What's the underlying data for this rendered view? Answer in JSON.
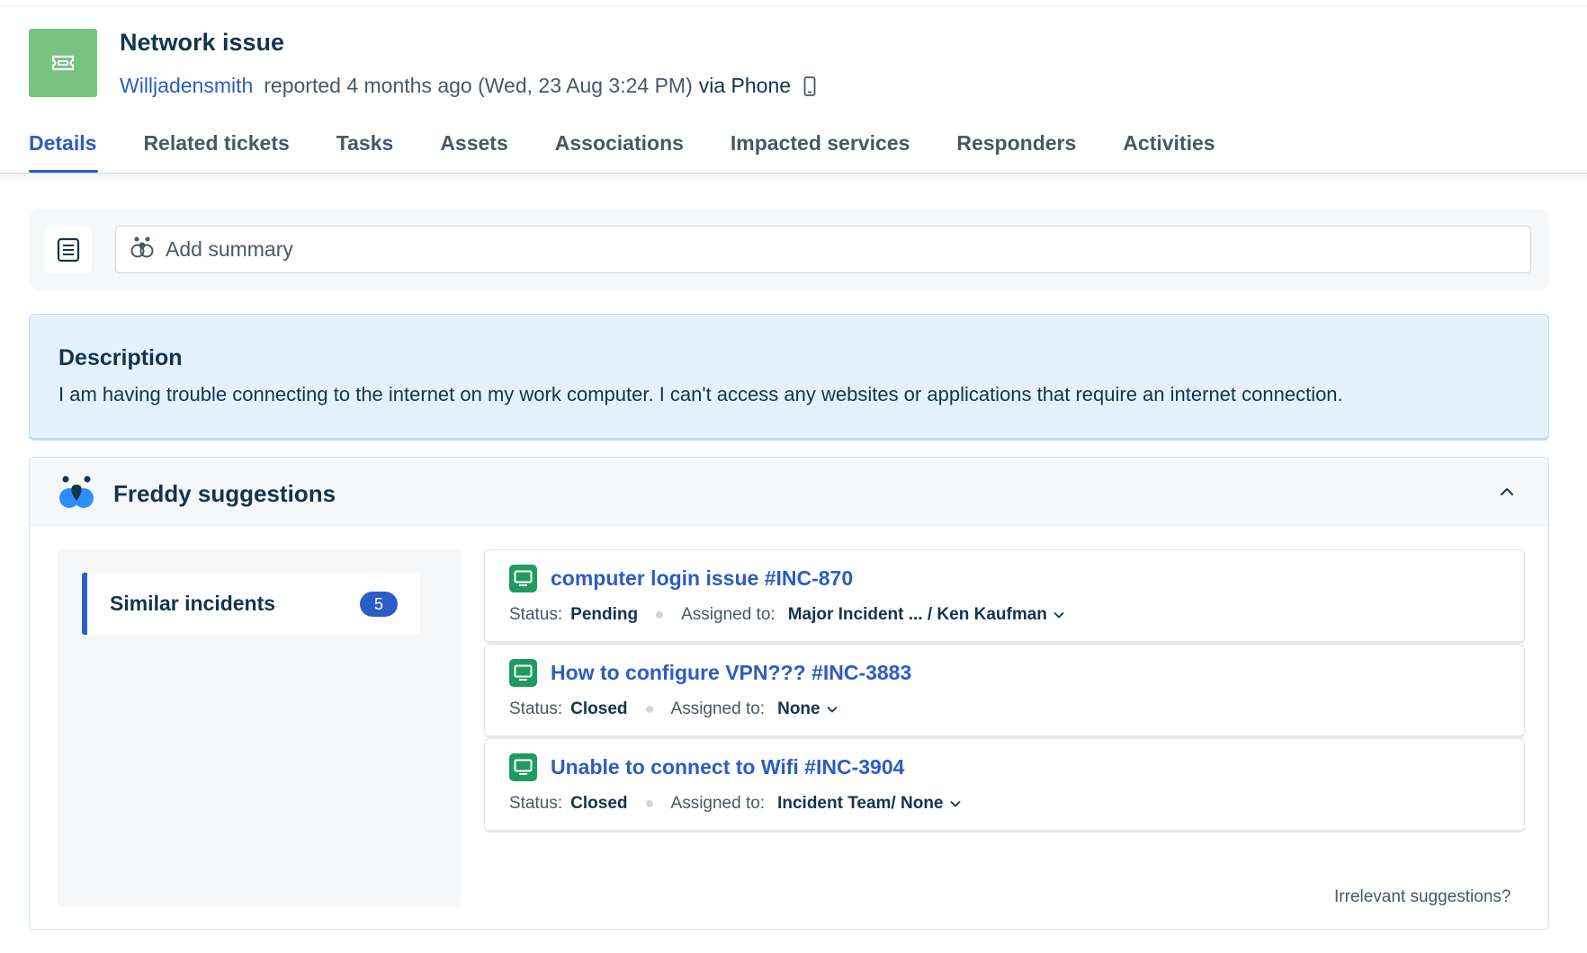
{
  "ticket": {
    "title": "Network issue",
    "icon": "ticket-icon",
    "icon_color": "#7ac27f",
    "requester": "Willjadensmith",
    "reported_text": "reported 4 months ago (Wed, 23 Aug 3:24 PM)",
    "via_text": "via Phone",
    "source_icon": "phone-icon"
  },
  "tabs": [
    {
      "label": "Details",
      "active": true
    },
    {
      "label": "Related tickets"
    },
    {
      "label": "Tasks"
    },
    {
      "label": "Assets"
    },
    {
      "label": "Associations"
    },
    {
      "label": "Impacted services"
    },
    {
      "label": "Responders"
    },
    {
      "label": "Activities"
    }
  ],
  "summary": {
    "placeholder": "Add summary",
    "icons": [
      "notes-icon",
      "freddy-icon"
    ]
  },
  "description": {
    "title": "Description",
    "text": "I am having trouble connecting to the internet on my work computer. I can't access any websites or applications that require an internet connection."
  },
  "freddy": {
    "title": "Freddy suggestions",
    "logo_icon": "freddy-icon",
    "collapse_icon": "chevron-up-icon",
    "similar_incidents": {
      "label": "Similar incidents",
      "count": "5"
    },
    "incidents": [
      {
        "title": "computer login issue #INC-870",
        "status_label": "Status:",
        "status": "Pending",
        "assigned_label": "Assigned to:",
        "assigned": "Major Incident ... / Ken Kaufman"
      },
      {
        "title": "How to configure VPN??? #INC-3883",
        "status_label": "Status:",
        "status": "Closed",
        "assigned_label": "Assigned to:",
        "assigned": "None"
      },
      {
        "title": "Unable to connect to Wifi #INC-3904",
        "status_label": "Status:",
        "status": "Closed",
        "assigned_label": "Assigned to:",
        "assigned": "Incident Team/ None"
      }
    ],
    "irrelevant_link": "Irrelevant suggestions?"
  },
  "colors": {
    "accent": "#2c5cc5",
    "text": "#12344d",
    "muted": "#475867",
    "incident_icon": "#1f9b5f",
    "description_bg": "#e5f2fd"
  }
}
